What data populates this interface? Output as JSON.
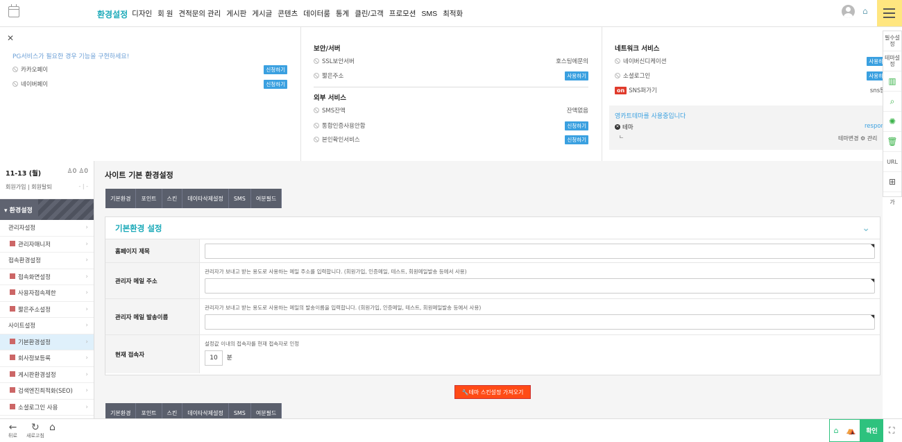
{
  "top_menu": {
    "active": "환경설정",
    "items": [
      "디자인",
      "회 원",
      "견적문의 관리",
      "게시판",
      "게시글",
      "콘텐츠",
      "데이터룸",
      "통계",
      "클린/고객",
      "프로모션",
      "SMS",
      "최적화"
    ]
  },
  "panel1": {
    "pg_notice": "PG서비스가 필요한 경우 기능을 구현하세요!",
    "rows": [
      {
        "label": "카카오페이",
        "action": "신청하기"
      },
      {
        "label": "네이버페이",
        "action": "신청하기"
      }
    ]
  },
  "panel2": {
    "sec1_title": "보안/서버",
    "sec1_rows": [
      {
        "label": "SSL보안서버",
        "value": "호스팅에문의"
      },
      {
        "label": "짧은주소",
        "action": "사용하기"
      }
    ],
    "sec2_title": "외부 서비스",
    "sec2_rows": [
      {
        "label": "SMS잔액",
        "value": "잔액없음"
      },
      {
        "label": "통합인증사용안함",
        "action": "신청하기"
      },
      {
        "label": "본인확인서비스",
        "action": "신청하기"
      }
    ]
  },
  "panel3": {
    "title": "네트워크 서비스",
    "rows": [
      {
        "label": "네이버신디케이션",
        "action": "사용하"
      },
      {
        "label": "소셜로그인",
        "action": "사용하"
      },
      {
        "badge": "on",
        "label": "SNS퍼가기",
        "value": "sns등"
      }
    ],
    "theme_notice": "영카트테마를 사용중입니다",
    "theme_label": "테마",
    "theme_value": "respon",
    "theme_sub": "ㄴ",
    "theme_actions": "테마변경 ⚙ 관리"
  },
  "sidebar": {
    "date": "11-13 (월)",
    "join_count": "0",
    "leave_count": "0",
    "join_label": "회원가입",
    "leave_label": "회원탈퇴",
    "header": "환경설정",
    "items": [
      {
        "label": "관리자설정",
        "sub": false
      },
      {
        "label": "관리자매니저",
        "sub": true
      },
      {
        "label": "접속환경설정",
        "sub": false
      },
      {
        "label": "접속화면설정",
        "sub": true
      },
      {
        "label": "사용자접속제한",
        "sub": true
      },
      {
        "label": "짧은주소설정",
        "sub": true
      },
      {
        "label": "사이트설정",
        "sub": false
      },
      {
        "label": "기본환경설정",
        "sub": true,
        "active": true
      },
      {
        "label": "회사정보등록",
        "sub": true
      },
      {
        "label": "게시판환경설정",
        "sub": true
      },
      {
        "label": "검색엔진최적화(SEO)",
        "sub": true
      },
      {
        "label": "소셜로그인 사용",
        "sub": true
      }
    ]
  },
  "main": {
    "page_title": "사이트 기본 환경설정",
    "tabs": [
      "기본환경",
      "포인트",
      "스킨",
      "데이타삭제설정",
      "SMS",
      "여분필드"
    ],
    "card_title": "기본환경 설정",
    "fields": [
      {
        "label": "홈페이지 제목",
        "hint": "",
        "value": ""
      },
      {
        "label": "관리자 메일 주소",
        "hint": "관리자가 보내고 받는 용도로 사용하는 메일 주소를 입력합니다. (회원가입, 인증메일, 테스트, 회원메일발송 등에서 사용)",
        "value": ""
      },
      {
        "label": "관리자 메일 발송이름",
        "hint": "관리자가 보내고 받는 용도로 사용하는 메일의 발송이름을 입력합니다. (회원가입, 인증메일, 테스트, 회원메일발송 등에서 사용)",
        "value": ""
      },
      {
        "label": "현재 접속자",
        "hint": "설정값 이내의 접속자를 현재 접속자로 인정",
        "value": "10",
        "unit": "분"
      }
    ],
    "theme_skin_button": "테마 스킨설정 가져오기"
  },
  "right_tools": [
    "필수설정",
    "테마설정",
    "chart-icon",
    "search-icon",
    "loading-icon",
    "trash-icon",
    "URL",
    "plus-box-icon",
    "가"
  ],
  "bottom": {
    "back": "뒤로",
    "refresh": "새로고침",
    "home": "",
    "confirm": "확인"
  },
  "colors": {
    "accent": "#1aa9b8",
    "confirm": "#2ec27e",
    "orange": "#ff4b16",
    "tab_bg": "#5a5f6c"
  }
}
